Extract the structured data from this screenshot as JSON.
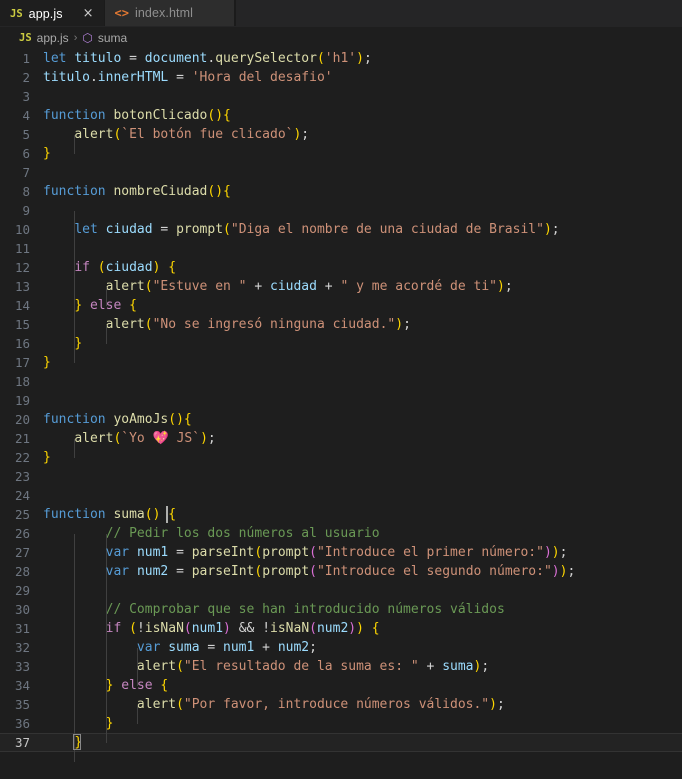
{
  "window": {
    "app": "Visual Studio Code",
    "theme": "Dark+"
  },
  "tabs": [
    {
      "icon": "js-file-icon",
      "icon_label": "JS",
      "label": "app.js",
      "active": true,
      "close_label": "×"
    },
    {
      "icon": "html-file-icon",
      "icon_label": "<>",
      "label": "index.html",
      "active": false,
      "close_label": "×"
    }
  ],
  "breadcrumb": {
    "file_icon_label": "JS",
    "file": "app.js",
    "separator": "›",
    "symbol_icon": "cube-icon",
    "symbol_icon_glyph": "⬡",
    "symbol": "suma"
  },
  "editor": {
    "language": "javascript",
    "total_lines": 37,
    "current_line": 37,
    "tab_size": 4,
    "colors": {
      "background": "#1e1e1e",
      "keyword": "#569cd6",
      "control_keyword": "#c586c0",
      "variable": "#9cdcfe",
      "function": "#dcdcaa",
      "string": "#ce9178",
      "comment": "#6a9955",
      "punctuation": "#d4d4d4",
      "bracket_yellow": "#ffd700",
      "bracket_pink": "#da70d6",
      "bracket_blue": "#179fff",
      "line_number": "#6e7681",
      "active_line_number": "#c6c6c6"
    },
    "lines": [
      {
        "n": 1,
        "text": "let titulo = document.querySelector('h1');"
      },
      {
        "n": 2,
        "text": "titulo.innerHTML = 'Hora del desafio'"
      },
      {
        "n": 3,
        "text": ""
      },
      {
        "n": 4,
        "text": "function botonClicado(){"
      },
      {
        "n": 5,
        "text": "    alert(`El botón fue clicado`);"
      },
      {
        "n": 6,
        "text": "}"
      },
      {
        "n": 7,
        "text": ""
      },
      {
        "n": 8,
        "text": "function nombreCiudad(){"
      },
      {
        "n": 9,
        "text": ""
      },
      {
        "n": 10,
        "text": "    let ciudad = prompt(\"Diga el nombre de una ciudad de Brasil\");"
      },
      {
        "n": 11,
        "text": ""
      },
      {
        "n": 12,
        "text": "    if (ciudad) {"
      },
      {
        "n": 13,
        "text": "        alert(\"Estuve en \" + ciudad + \" y me acordé de ti\");"
      },
      {
        "n": 14,
        "text": "    } else {"
      },
      {
        "n": 15,
        "text": "        alert(\"No se ingresó ninguna ciudad.\");"
      },
      {
        "n": 16,
        "text": "    }"
      },
      {
        "n": 17,
        "text": "}"
      },
      {
        "n": 18,
        "text": ""
      },
      {
        "n": 19,
        "text": ""
      },
      {
        "n": 20,
        "text": "function yoAmoJs(){"
      },
      {
        "n": 21,
        "text": "    alert(`Yo 💖 JS`);"
      },
      {
        "n": 22,
        "text": "}"
      },
      {
        "n": 23,
        "text": ""
      },
      {
        "n": 24,
        "text": ""
      },
      {
        "n": 25,
        "text": "function suma() {"
      },
      {
        "n": 26,
        "text": "        // Pedir los dos números al usuario"
      },
      {
        "n": 27,
        "text": "        var num1 = parseInt(prompt(\"Introduce el primer número:\"));"
      },
      {
        "n": 28,
        "text": "        var num2 = parseInt(prompt(\"Introduce el segundo número:\"));"
      },
      {
        "n": 29,
        "text": ""
      },
      {
        "n": 30,
        "text": "        // Comprobar que se han introducido números válidos"
      },
      {
        "n": 31,
        "text": "        if (!isNaN(num1) && !isNaN(num2)) {"
      },
      {
        "n": 32,
        "text": "            var suma = num1 + num2;"
      },
      {
        "n": 33,
        "text": "            alert(\"El resultado de la suma es: \" + suma);"
      },
      {
        "n": 34,
        "text": "        } else {"
      },
      {
        "n": 35,
        "text": "            alert(\"Por favor, introduce números válidos.\");"
      },
      {
        "n": 36,
        "text": "        }"
      },
      {
        "n": 37,
        "text": "    }"
      }
    ]
  }
}
